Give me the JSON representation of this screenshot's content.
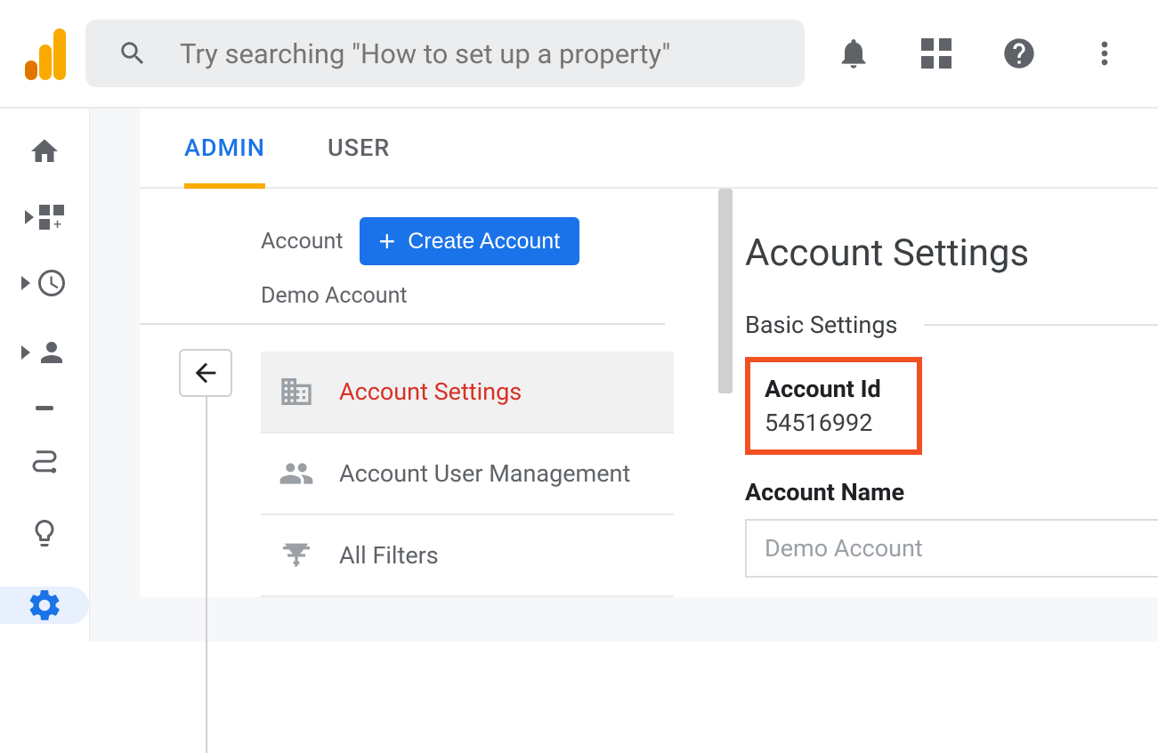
{
  "header": {
    "search_placeholder": "Try searching \"How to set up a property\""
  },
  "tabs": {
    "admin": "ADMIN",
    "user": "USER"
  },
  "account_column": {
    "label": "Account",
    "create_button": "Create Account",
    "account_name": "Demo Account",
    "menu": {
      "settings": "Account Settings",
      "user_mgmt": "Account User Management",
      "filters": "All Filters"
    }
  },
  "settings_panel": {
    "title": "Account Settings",
    "section": "Basic Settings",
    "account_id_label": "Account Id",
    "account_id_value": "54516992",
    "account_name_label": "Account Name",
    "account_name_value": "Demo Account"
  }
}
